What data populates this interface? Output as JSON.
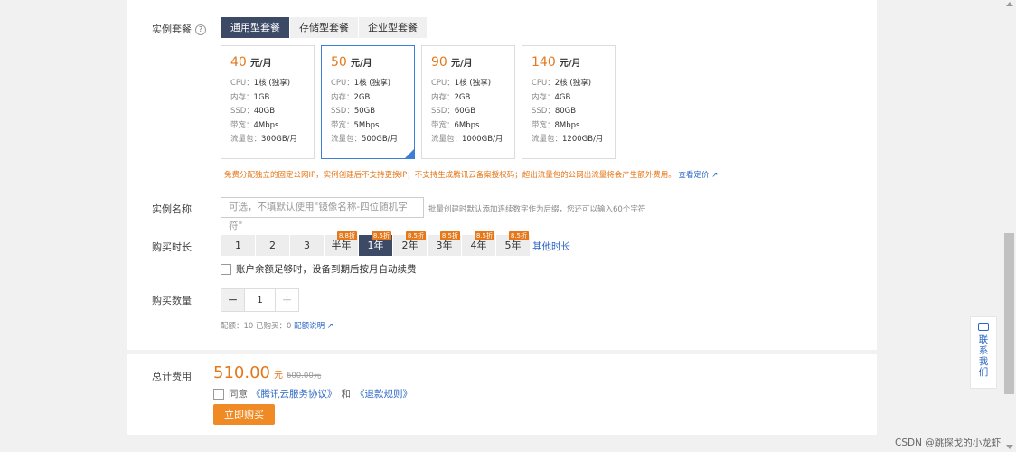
{
  "labels": {
    "instance_package": "实例套餐",
    "instance_name": "实例名称",
    "duration": "购买时长",
    "quantity": "购买数量",
    "total": "总计费用"
  },
  "package_tabs": [
    "通用型套餐",
    "存储型套餐",
    "企业型套餐"
  ],
  "plans": [
    {
      "price": "40",
      "unit": "元/月",
      "cpu": "1核 (独享)",
      "mem": "1GB",
      "ssd": "40GB",
      "bw": "4Mbps",
      "traffic": "300GB/月"
    },
    {
      "price": "50",
      "unit": "元/月",
      "cpu": "1核 (独享)",
      "mem": "2GB",
      "ssd": "50GB",
      "bw": "5Mbps",
      "traffic": "500GB/月"
    },
    {
      "price": "90",
      "unit": "元/月",
      "cpu": "1核 (独享)",
      "mem": "2GB",
      "ssd": "60GB",
      "bw": "6Mbps",
      "traffic": "1000GB/月"
    },
    {
      "price": "140",
      "unit": "元/月",
      "cpu": "2核 (独享)",
      "mem": "4GB",
      "ssd": "80GB",
      "bw": "8Mbps",
      "traffic": "1200GB/月"
    }
  ],
  "spec_labels": {
    "cpu": "CPU：",
    "mem": "内存：",
    "ssd": "SSD：",
    "bw": "带宽：",
    "traffic": "流量包："
  },
  "notice": {
    "text": "免费分配独立的固定公网IP，实例创建后不支持更换IP；不支持生成腾讯云备案授权码；超出流量包的公网出流量将会产生额外费用。",
    "link": "查看定价"
  },
  "name_input": {
    "placeholder": "可选，不填默认使用\"镜像名称-四位随机字符\"",
    "hint": "批量创建时默认添加连续数字作为后缀，您还可以输入60个字符"
  },
  "durations": [
    {
      "label": "1",
      "badge": ""
    },
    {
      "label": "2",
      "badge": ""
    },
    {
      "label": "3",
      "badge": ""
    },
    {
      "label": "半年",
      "badge": "8.8折"
    },
    {
      "label": "1年",
      "badge": "8.5折"
    },
    {
      "label": "2年",
      "badge": "8.5折"
    },
    {
      "label": "3年",
      "badge": "8.5折"
    },
    {
      "label": "4年",
      "badge": "8.5折"
    },
    {
      "label": "5年",
      "badge": "8.5折"
    }
  ],
  "other_duration": "其他时长",
  "auto_renew": "账户余额足够时，设备到期后按月自动续费",
  "quantity": {
    "minus": "−",
    "value": "1",
    "plus": "+"
  },
  "quota": {
    "text": "配额：10  已购买：0",
    "link": "配额说明"
  },
  "total": {
    "amount": "510.00",
    "unit": "元",
    "original": "600.00元"
  },
  "agreement": {
    "prefix": "同意",
    "link1": "《腾讯云服务协议》",
    "and": "和",
    "link2": "《退款规则》"
  },
  "buy_button": "立即购买",
  "contact": "联系我们",
  "watermark": "CSDN @跳探戈的小龙虾"
}
